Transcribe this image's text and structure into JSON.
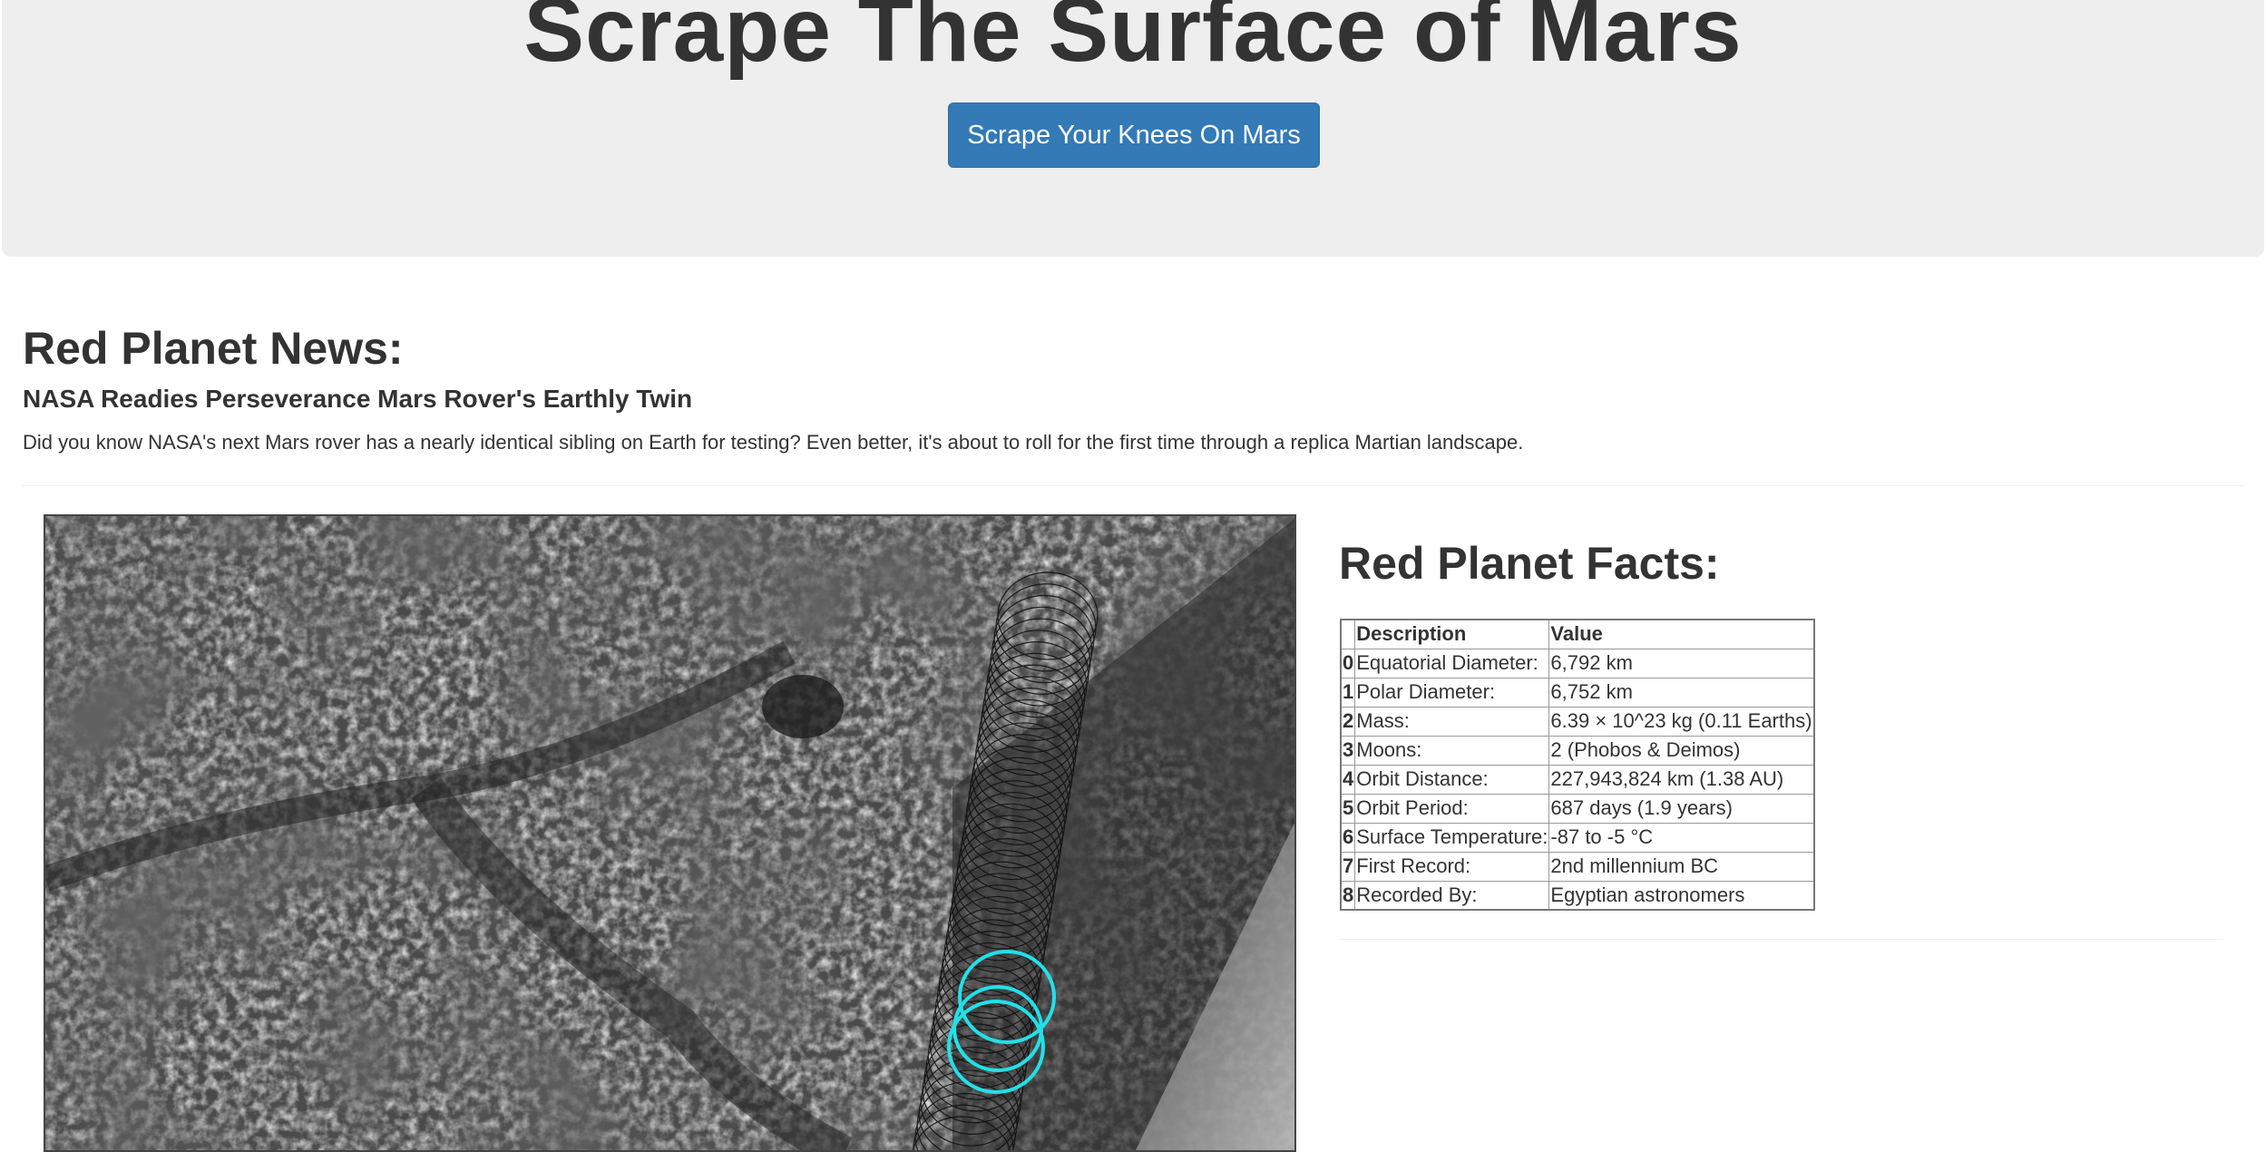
{
  "header": {
    "title": "Scrape The Surface of Mars",
    "button_label": "Scrape Your Knees On Mars"
  },
  "news": {
    "heading": "Red Planet News:",
    "title": "NASA Readies Perseverance Mars Rover's Earthly Twin",
    "paragraph": "Did you know NASA's next Mars rover has a nearly identical sibling on Earth for testing? Even better, it's about to roll for the first time through a replica Martian landscape."
  },
  "facts": {
    "heading": "Red Planet Facts:",
    "columns": [
      "",
      "Description",
      "Value"
    ],
    "rows": [
      {
        "index": "0",
        "description": "Equatorial Diameter:",
        "value": "6,792 km"
      },
      {
        "index": "1",
        "description": "Polar Diameter:",
        "value": "6,752 km"
      },
      {
        "index": "2",
        "description": "Mass:",
        "value": "6.39 × 10^23 kg (0.11 Earths)"
      },
      {
        "index": "3",
        "description": "Moons:",
        "value": "2 (Phobos & Deimos)"
      },
      {
        "index": "4",
        "description": "Orbit Distance:",
        "value": "227,943,824 km (1.38 AU)"
      },
      {
        "index": "5",
        "description": "Orbit Period:",
        "value": "687 days (1.9 years)"
      },
      {
        "index": "6",
        "description": "Surface Temperature:",
        "value": "-87 to -5 °C"
      },
      {
        "index": "7",
        "description": "First Record:",
        "value": "2nd millennium BC"
      },
      {
        "index": "8",
        "description": "Recorded By:",
        "value": "Egyptian astronomers"
      }
    ]
  },
  "colors": {
    "button": "#337ab7",
    "jumbotron": "#eeeeee",
    "circle_highlight": "#22e0e8"
  }
}
